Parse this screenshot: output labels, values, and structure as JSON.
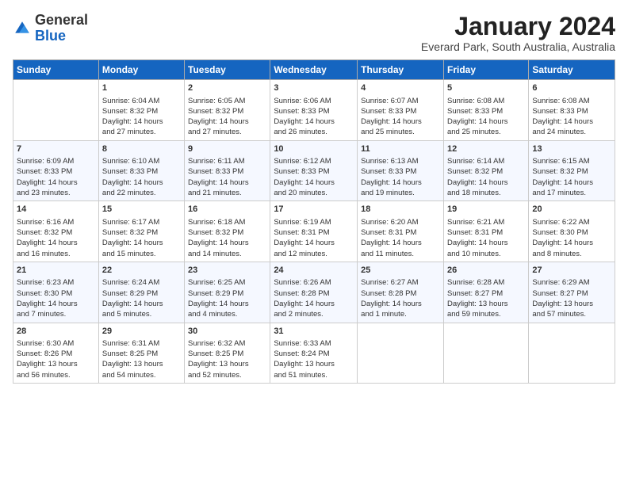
{
  "header": {
    "logo_general": "General",
    "logo_blue": "Blue",
    "title": "January 2024",
    "subtitle": "Everard Park, South Australia, Australia"
  },
  "days_of_week": [
    "Sunday",
    "Monday",
    "Tuesday",
    "Wednesday",
    "Thursday",
    "Friday",
    "Saturday"
  ],
  "weeks": [
    [
      {
        "day": "",
        "content": ""
      },
      {
        "day": "1",
        "content": "Sunrise: 6:04 AM\nSunset: 8:32 PM\nDaylight: 14 hours\nand 27 minutes."
      },
      {
        "day": "2",
        "content": "Sunrise: 6:05 AM\nSunset: 8:32 PM\nDaylight: 14 hours\nand 27 minutes."
      },
      {
        "day": "3",
        "content": "Sunrise: 6:06 AM\nSunset: 8:33 PM\nDaylight: 14 hours\nand 26 minutes."
      },
      {
        "day": "4",
        "content": "Sunrise: 6:07 AM\nSunset: 8:33 PM\nDaylight: 14 hours\nand 25 minutes."
      },
      {
        "day": "5",
        "content": "Sunrise: 6:08 AM\nSunset: 8:33 PM\nDaylight: 14 hours\nand 25 minutes."
      },
      {
        "day": "6",
        "content": "Sunrise: 6:08 AM\nSunset: 8:33 PM\nDaylight: 14 hours\nand 24 minutes."
      }
    ],
    [
      {
        "day": "7",
        "content": "Sunrise: 6:09 AM\nSunset: 8:33 PM\nDaylight: 14 hours\nand 23 minutes."
      },
      {
        "day": "8",
        "content": "Sunrise: 6:10 AM\nSunset: 8:33 PM\nDaylight: 14 hours\nand 22 minutes."
      },
      {
        "day": "9",
        "content": "Sunrise: 6:11 AM\nSunset: 8:33 PM\nDaylight: 14 hours\nand 21 minutes."
      },
      {
        "day": "10",
        "content": "Sunrise: 6:12 AM\nSunset: 8:33 PM\nDaylight: 14 hours\nand 20 minutes."
      },
      {
        "day": "11",
        "content": "Sunrise: 6:13 AM\nSunset: 8:33 PM\nDaylight: 14 hours\nand 19 minutes."
      },
      {
        "day": "12",
        "content": "Sunrise: 6:14 AM\nSunset: 8:32 PM\nDaylight: 14 hours\nand 18 minutes."
      },
      {
        "day": "13",
        "content": "Sunrise: 6:15 AM\nSunset: 8:32 PM\nDaylight: 14 hours\nand 17 minutes."
      }
    ],
    [
      {
        "day": "14",
        "content": "Sunrise: 6:16 AM\nSunset: 8:32 PM\nDaylight: 14 hours\nand 16 minutes."
      },
      {
        "day": "15",
        "content": "Sunrise: 6:17 AM\nSunset: 8:32 PM\nDaylight: 14 hours\nand 15 minutes."
      },
      {
        "day": "16",
        "content": "Sunrise: 6:18 AM\nSunset: 8:32 PM\nDaylight: 14 hours\nand 14 minutes."
      },
      {
        "day": "17",
        "content": "Sunrise: 6:19 AM\nSunset: 8:31 PM\nDaylight: 14 hours\nand 12 minutes."
      },
      {
        "day": "18",
        "content": "Sunrise: 6:20 AM\nSunset: 8:31 PM\nDaylight: 14 hours\nand 11 minutes."
      },
      {
        "day": "19",
        "content": "Sunrise: 6:21 AM\nSunset: 8:31 PM\nDaylight: 14 hours\nand 10 minutes."
      },
      {
        "day": "20",
        "content": "Sunrise: 6:22 AM\nSunset: 8:30 PM\nDaylight: 14 hours\nand 8 minutes."
      }
    ],
    [
      {
        "day": "21",
        "content": "Sunrise: 6:23 AM\nSunset: 8:30 PM\nDaylight: 14 hours\nand 7 minutes."
      },
      {
        "day": "22",
        "content": "Sunrise: 6:24 AM\nSunset: 8:29 PM\nDaylight: 14 hours\nand 5 minutes."
      },
      {
        "day": "23",
        "content": "Sunrise: 6:25 AM\nSunset: 8:29 PM\nDaylight: 14 hours\nand 4 minutes."
      },
      {
        "day": "24",
        "content": "Sunrise: 6:26 AM\nSunset: 8:28 PM\nDaylight: 14 hours\nand 2 minutes."
      },
      {
        "day": "25",
        "content": "Sunrise: 6:27 AM\nSunset: 8:28 PM\nDaylight: 14 hours\nand 1 minute."
      },
      {
        "day": "26",
        "content": "Sunrise: 6:28 AM\nSunset: 8:27 PM\nDaylight: 13 hours\nand 59 minutes."
      },
      {
        "day": "27",
        "content": "Sunrise: 6:29 AM\nSunset: 8:27 PM\nDaylight: 13 hours\nand 57 minutes."
      }
    ],
    [
      {
        "day": "28",
        "content": "Sunrise: 6:30 AM\nSunset: 8:26 PM\nDaylight: 13 hours\nand 56 minutes."
      },
      {
        "day": "29",
        "content": "Sunrise: 6:31 AM\nSunset: 8:25 PM\nDaylight: 13 hours\nand 54 minutes."
      },
      {
        "day": "30",
        "content": "Sunrise: 6:32 AM\nSunset: 8:25 PM\nDaylight: 13 hours\nand 52 minutes."
      },
      {
        "day": "31",
        "content": "Sunrise: 6:33 AM\nSunset: 8:24 PM\nDaylight: 13 hours\nand 51 minutes."
      },
      {
        "day": "",
        "content": ""
      },
      {
        "day": "",
        "content": ""
      },
      {
        "day": "",
        "content": ""
      }
    ]
  ]
}
